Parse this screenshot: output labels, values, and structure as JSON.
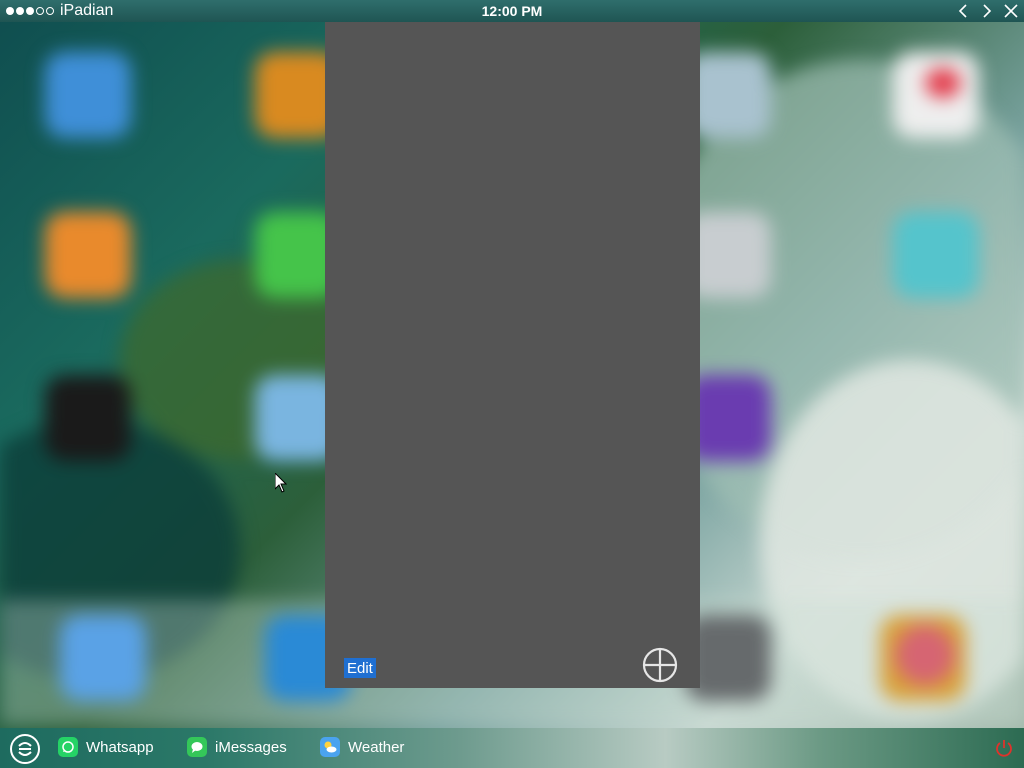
{
  "statusbar": {
    "carrier_name": "iPadian",
    "time": "12:00 PM",
    "signal_full": 3,
    "signal_empty": 2
  },
  "panel": {
    "edit_label": "Edit"
  },
  "taskbar": {
    "items": [
      {
        "label": "Whatsapp",
        "icon": "whatsapp-icon",
        "color": "#25d366"
      },
      {
        "label": "iMessages",
        "icon": "imessages-icon",
        "color": "#34c759"
      },
      {
        "label": "Weather",
        "icon": "weather-icon",
        "color": "#4aa3ef"
      }
    ]
  },
  "colors": {
    "edit_button": "#1f6fd1",
    "panel": "#555555",
    "power": "#e0322b"
  }
}
